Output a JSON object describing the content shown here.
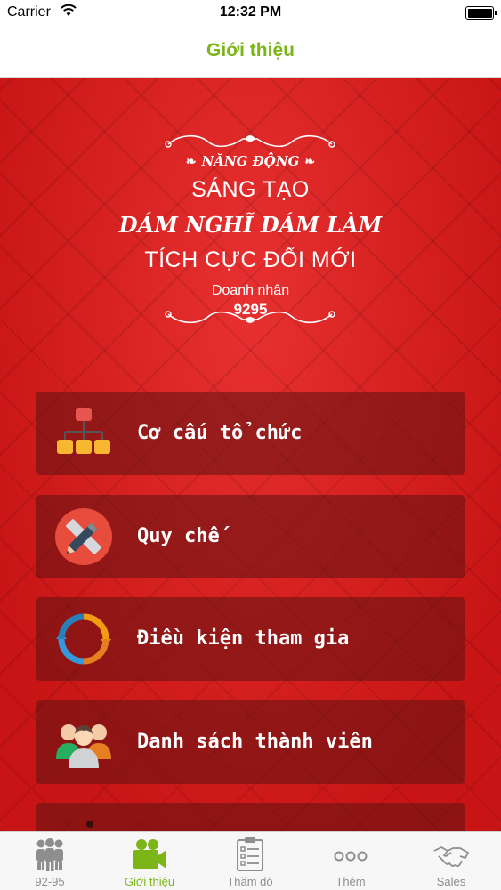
{
  "status_bar": {
    "carrier": "Carrier",
    "time": "12:32 PM"
  },
  "nav": {
    "title": "Giới thiệu"
  },
  "banner": {
    "line1": "NĂNG ĐỘNG",
    "line2": "SÁNG TẠO",
    "line3": "DÁM NGHĨ DÁM LÀM",
    "line4": "TÍCH CỰC ĐỔI MỚI",
    "line5": "Doanh nhân",
    "line6": "9295"
  },
  "menu": [
    {
      "label": "Cơ cấu tổ chức",
      "icon": "org-chart-icon"
    },
    {
      "label": "Quy chế",
      "icon": "pencil-ruler-icon"
    },
    {
      "label": "Điều kiện tham gia",
      "icon": "cycle-arrows-icon"
    },
    {
      "label": "Danh sách thành viên",
      "icon": "members-icon"
    }
  ],
  "tabs": [
    {
      "label": "92-95",
      "icon": "group-icon"
    },
    {
      "label": "Giới thiệu",
      "icon": "video-camera-icon"
    },
    {
      "label": "Thăm dò",
      "icon": "survey-icon"
    },
    {
      "label": "Thêm",
      "icon": "more-dots-icon"
    },
    {
      "label": "Sales",
      "icon": "handshake-icon"
    }
  ],
  "colors": {
    "accent": "#7cb518",
    "background": "#d81e1e",
    "card": "#5f1212"
  }
}
